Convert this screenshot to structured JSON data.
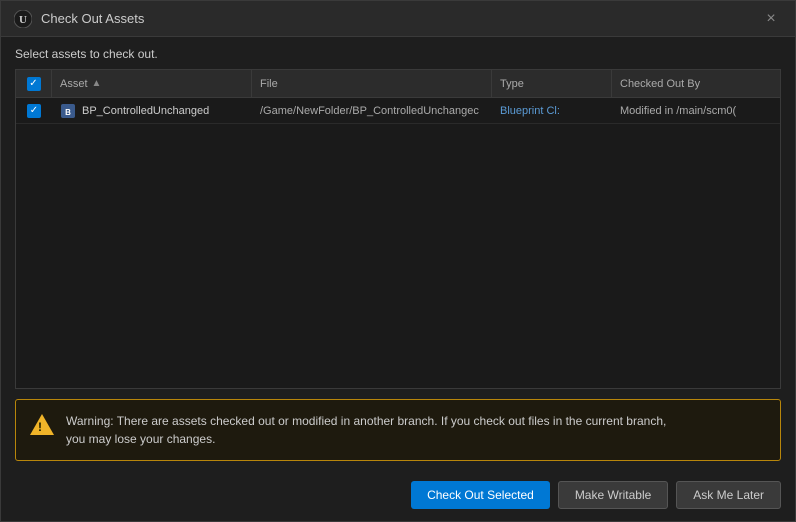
{
  "dialog": {
    "title": "Check Out Assets",
    "subtitle": "Select assets to check out.",
    "close_label": "×"
  },
  "table": {
    "columns": [
      {
        "id": "check",
        "label": ""
      },
      {
        "id": "asset",
        "label": "Asset",
        "sort": "asc"
      },
      {
        "id": "file",
        "label": "File"
      },
      {
        "id": "type",
        "label": "Type"
      },
      {
        "id": "checkedout",
        "label": "Checked Out By"
      }
    ],
    "rows": [
      {
        "checked": true,
        "asset": "BP_ControlledUnchanged",
        "file": "/Game/NewFolder/BP_ControlledUnchangec",
        "type": "Blueprint Cl:",
        "checkedout": "Modified in /main/scm0("
      }
    ]
  },
  "warning": {
    "text_line1": "Warning: There are assets checked out or modified in another branch.  If you check out files in the current branch,",
    "text_line2": "you may lose your changes."
  },
  "footer": {
    "checkout_label": "Check Out Selected",
    "writable_label": "Make Writable",
    "later_label": "Ask Me Later"
  }
}
